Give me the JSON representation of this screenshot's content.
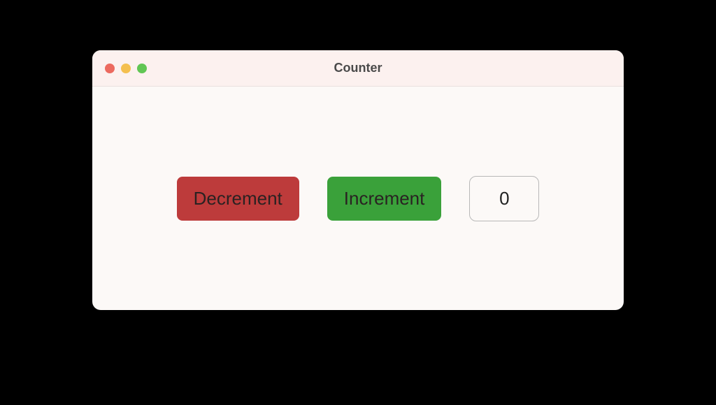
{
  "window": {
    "title": "Counter"
  },
  "controls": {
    "decrement_label": "Decrement",
    "increment_label": "Increment",
    "counter_value": "0"
  },
  "colors": {
    "decrement_bg": "#bd3b3b",
    "increment_bg": "#3aa13a"
  }
}
